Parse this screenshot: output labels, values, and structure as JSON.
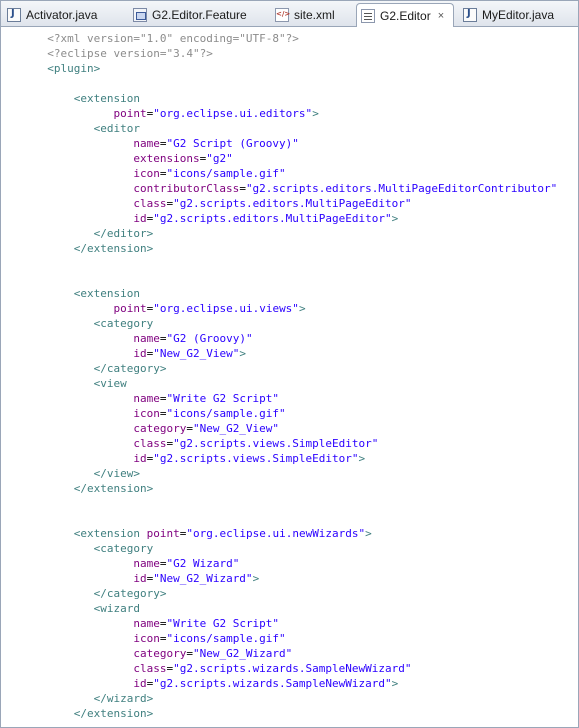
{
  "tabs": [
    {
      "label": "Activator.java",
      "icon": "java-file-icon",
      "active": false
    },
    {
      "label": "G2.Editor.Feature",
      "icon": "feature-icon",
      "active": false
    },
    {
      "label": "site.xml",
      "icon": "xml-file-icon",
      "active": false
    },
    {
      "label": "G2.Editor",
      "icon": "editor-icon",
      "active": true,
      "close": "×"
    },
    {
      "label": "MyEditor.java",
      "icon": "java-file-icon",
      "active": false
    }
  ],
  "colors": {
    "tag": "#3f7f7f",
    "attribute": "#7f007f",
    "value": "#2a00ff",
    "processing": "#8c8c8c"
  },
  "code": [
    [
      [
        "  ",
        "p"
      ],
      [
        "<?xml version=\"1.0\" encoding=\"UTF-8\"?>",
        "p"
      ]
    ],
    [
      [
        "  ",
        "p"
      ],
      [
        "<?eclipse version=\"3.4\"?>",
        "p"
      ]
    ],
    [
      [
        "  ",
        "t"
      ],
      [
        "<plugin>",
        "t"
      ]
    ],
    [],
    [
      [
        "      ",
        "t"
      ],
      [
        "<extension",
        "t"
      ]
    ],
    [
      [
        "            ",
        "t"
      ],
      [
        "point",
        "a"
      ],
      [
        "=",
        "e"
      ],
      [
        "\"org.eclipse.ui.editors\"",
        "v"
      ],
      [
        ">",
        "t"
      ]
    ],
    [
      [
        "         ",
        "t"
      ],
      [
        "<editor",
        "t"
      ]
    ],
    [
      [
        "               ",
        "t"
      ],
      [
        "name",
        "a"
      ],
      [
        "=",
        "e"
      ],
      [
        "\"G2 Script (Groovy)\"",
        "v"
      ]
    ],
    [
      [
        "               ",
        "t"
      ],
      [
        "extensions",
        "a"
      ],
      [
        "=",
        "e"
      ],
      [
        "\"g2\"",
        "v"
      ]
    ],
    [
      [
        "               ",
        "t"
      ],
      [
        "icon",
        "a"
      ],
      [
        "=",
        "e"
      ],
      [
        "\"icons/sample.gif\"",
        "v"
      ]
    ],
    [
      [
        "               ",
        "t"
      ],
      [
        "contributorClass",
        "a"
      ],
      [
        "=",
        "e"
      ],
      [
        "\"g2.scripts.editors.MultiPageEditorContributor\"",
        "v"
      ]
    ],
    [
      [
        "               ",
        "t"
      ],
      [
        "class",
        "a"
      ],
      [
        "=",
        "e"
      ],
      [
        "\"g2.scripts.editors.MultiPageEditor\"",
        "v"
      ]
    ],
    [
      [
        "               ",
        "t"
      ],
      [
        "id",
        "a"
      ],
      [
        "=",
        "e"
      ],
      [
        "\"g2.scripts.editors.MultiPageEditor\"",
        "v"
      ],
      [
        ">",
        "t"
      ]
    ],
    [
      [
        "         ",
        "t"
      ],
      [
        "</editor>",
        "t"
      ]
    ],
    [
      [
        "      ",
        "t"
      ],
      [
        "</extension>",
        "t"
      ]
    ],
    [],
    [],
    [
      [
        "      ",
        "t"
      ],
      [
        "<extension",
        "t"
      ]
    ],
    [
      [
        "            ",
        "t"
      ],
      [
        "point",
        "a"
      ],
      [
        "=",
        "e"
      ],
      [
        "\"org.eclipse.ui.views\"",
        "v"
      ],
      [
        ">",
        "t"
      ]
    ],
    [
      [
        "         ",
        "t"
      ],
      [
        "<category",
        "t"
      ]
    ],
    [
      [
        "               ",
        "t"
      ],
      [
        "name",
        "a"
      ],
      [
        "=",
        "e"
      ],
      [
        "\"G2 (Groovy)\"",
        "v"
      ]
    ],
    [
      [
        "               ",
        "t"
      ],
      [
        "id",
        "a"
      ],
      [
        "=",
        "e"
      ],
      [
        "\"New_G2_View\"",
        "v"
      ],
      [
        ">",
        "t"
      ]
    ],
    [
      [
        "         ",
        "t"
      ],
      [
        "</category>",
        "t"
      ]
    ],
    [
      [
        "         ",
        "t"
      ],
      [
        "<view",
        "t"
      ]
    ],
    [
      [
        "               ",
        "t"
      ],
      [
        "name",
        "a"
      ],
      [
        "=",
        "e"
      ],
      [
        "\"Write G2 Script\"",
        "v"
      ]
    ],
    [
      [
        "               ",
        "t"
      ],
      [
        "icon",
        "a"
      ],
      [
        "=",
        "e"
      ],
      [
        "\"icons/sample.gif\"",
        "v"
      ]
    ],
    [
      [
        "               ",
        "t"
      ],
      [
        "category",
        "a"
      ],
      [
        "=",
        "e"
      ],
      [
        "\"New_G2_View\"",
        "v"
      ]
    ],
    [
      [
        "               ",
        "t"
      ],
      [
        "class",
        "a"
      ],
      [
        "=",
        "e"
      ],
      [
        "\"g2.scripts.views.SimpleEditor\"",
        "v"
      ]
    ],
    [
      [
        "               ",
        "t"
      ],
      [
        "id",
        "a"
      ],
      [
        "=",
        "e"
      ],
      [
        "\"g2.scripts.views.SimpleEditor\"",
        "v"
      ],
      [
        ">",
        "t"
      ]
    ],
    [
      [
        "         ",
        "t"
      ],
      [
        "</view>",
        "t"
      ]
    ],
    [
      [
        "      ",
        "t"
      ],
      [
        "</extension>",
        "t"
      ]
    ],
    [],
    [],
    [
      [
        "      ",
        "t"
      ],
      [
        "<extension ",
        "t"
      ],
      [
        "point",
        "a"
      ],
      [
        "=",
        "e"
      ],
      [
        "\"org.eclipse.ui.newWizards\"",
        "v"
      ],
      [
        ">",
        "t"
      ]
    ],
    [
      [
        "         ",
        "t"
      ],
      [
        "<category",
        "t"
      ]
    ],
    [
      [
        "               ",
        "t"
      ],
      [
        "name",
        "a"
      ],
      [
        "=",
        "e"
      ],
      [
        "\"G2 Wizard\"",
        "v"
      ]
    ],
    [
      [
        "               ",
        "t"
      ],
      [
        "id",
        "a"
      ],
      [
        "=",
        "e"
      ],
      [
        "\"New_G2_Wizard\"",
        "v"
      ],
      [
        ">",
        "t"
      ]
    ],
    [
      [
        "         ",
        "t"
      ],
      [
        "</category>",
        "t"
      ]
    ],
    [
      [
        "         ",
        "t"
      ],
      [
        "<wizard",
        "t"
      ]
    ],
    [
      [
        "               ",
        "t"
      ],
      [
        "name",
        "a"
      ],
      [
        "=",
        "e"
      ],
      [
        "\"Write G2 Script\"",
        "v"
      ]
    ],
    [
      [
        "               ",
        "t"
      ],
      [
        "icon",
        "a"
      ],
      [
        "=",
        "e"
      ],
      [
        "\"icons/sample.gif\"",
        "v"
      ]
    ],
    [
      [
        "               ",
        "t"
      ],
      [
        "category",
        "a"
      ],
      [
        "=",
        "e"
      ],
      [
        "\"New_G2_Wizard\"",
        "v"
      ]
    ],
    [
      [
        "               ",
        "t"
      ],
      [
        "class",
        "a"
      ],
      [
        "=",
        "e"
      ],
      [
        "\"g2.scripts.wizards.SampleNewWizard\"",
        "v"
      ]
    ],
    [
      [
        "               ",
        "t"
      ],
      [
        "id",
        "a"
      ],
      [
        "=",
        "e"
      ],
      [
        "\"g2.scripts.wizards.SampleNewWizard\"",
        "v"
      ],
      [
        ">",
        "t"
      ]
    ],
    [
      [
        "         ",
        "t"
      ],
      [
        "</wizard>",
        "t"
      ]
    ],
    [
      [
        "      ",
        "t"
      ],
      [
        "</extension>",
        "t"
      ]
    ]
  ]
}
